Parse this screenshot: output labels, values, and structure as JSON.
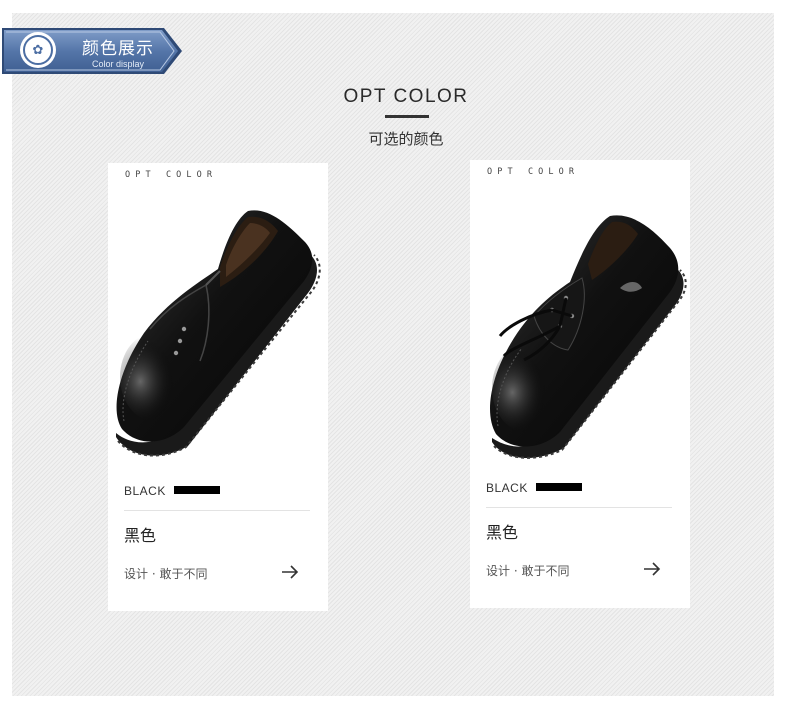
{
  "header": {
    "title_cn": "颜色展示",
    "title_en": "Color display",
    "logo_icon": "brand-logo-icon",
    "ribbon_color": "#4c6ea3"
  },
  "section": {
    "title": "OPT COLOR",
    "subtitle": "可选的颜色"
  },
  "cards": [
    {
      "opt_label": "O P T   C O L O R",
      "color_en": "BLACK",
      "color_cn": "黑色",
      "slogan": "设计 · 敢于不同",
      "swatch_color": "#000000",
      "shoe_style": "slip-on loafer"
    },
    {
      "opt_label": "O P T   C O L O R",
      "color_en": "BLACK",
      "color_cn": "黑色",
      "slogan": "设计 · 敢于不同",
      "swatch_color": "#000000",
      "shoe_style": "lace-up derby"
    }
  ]
}
